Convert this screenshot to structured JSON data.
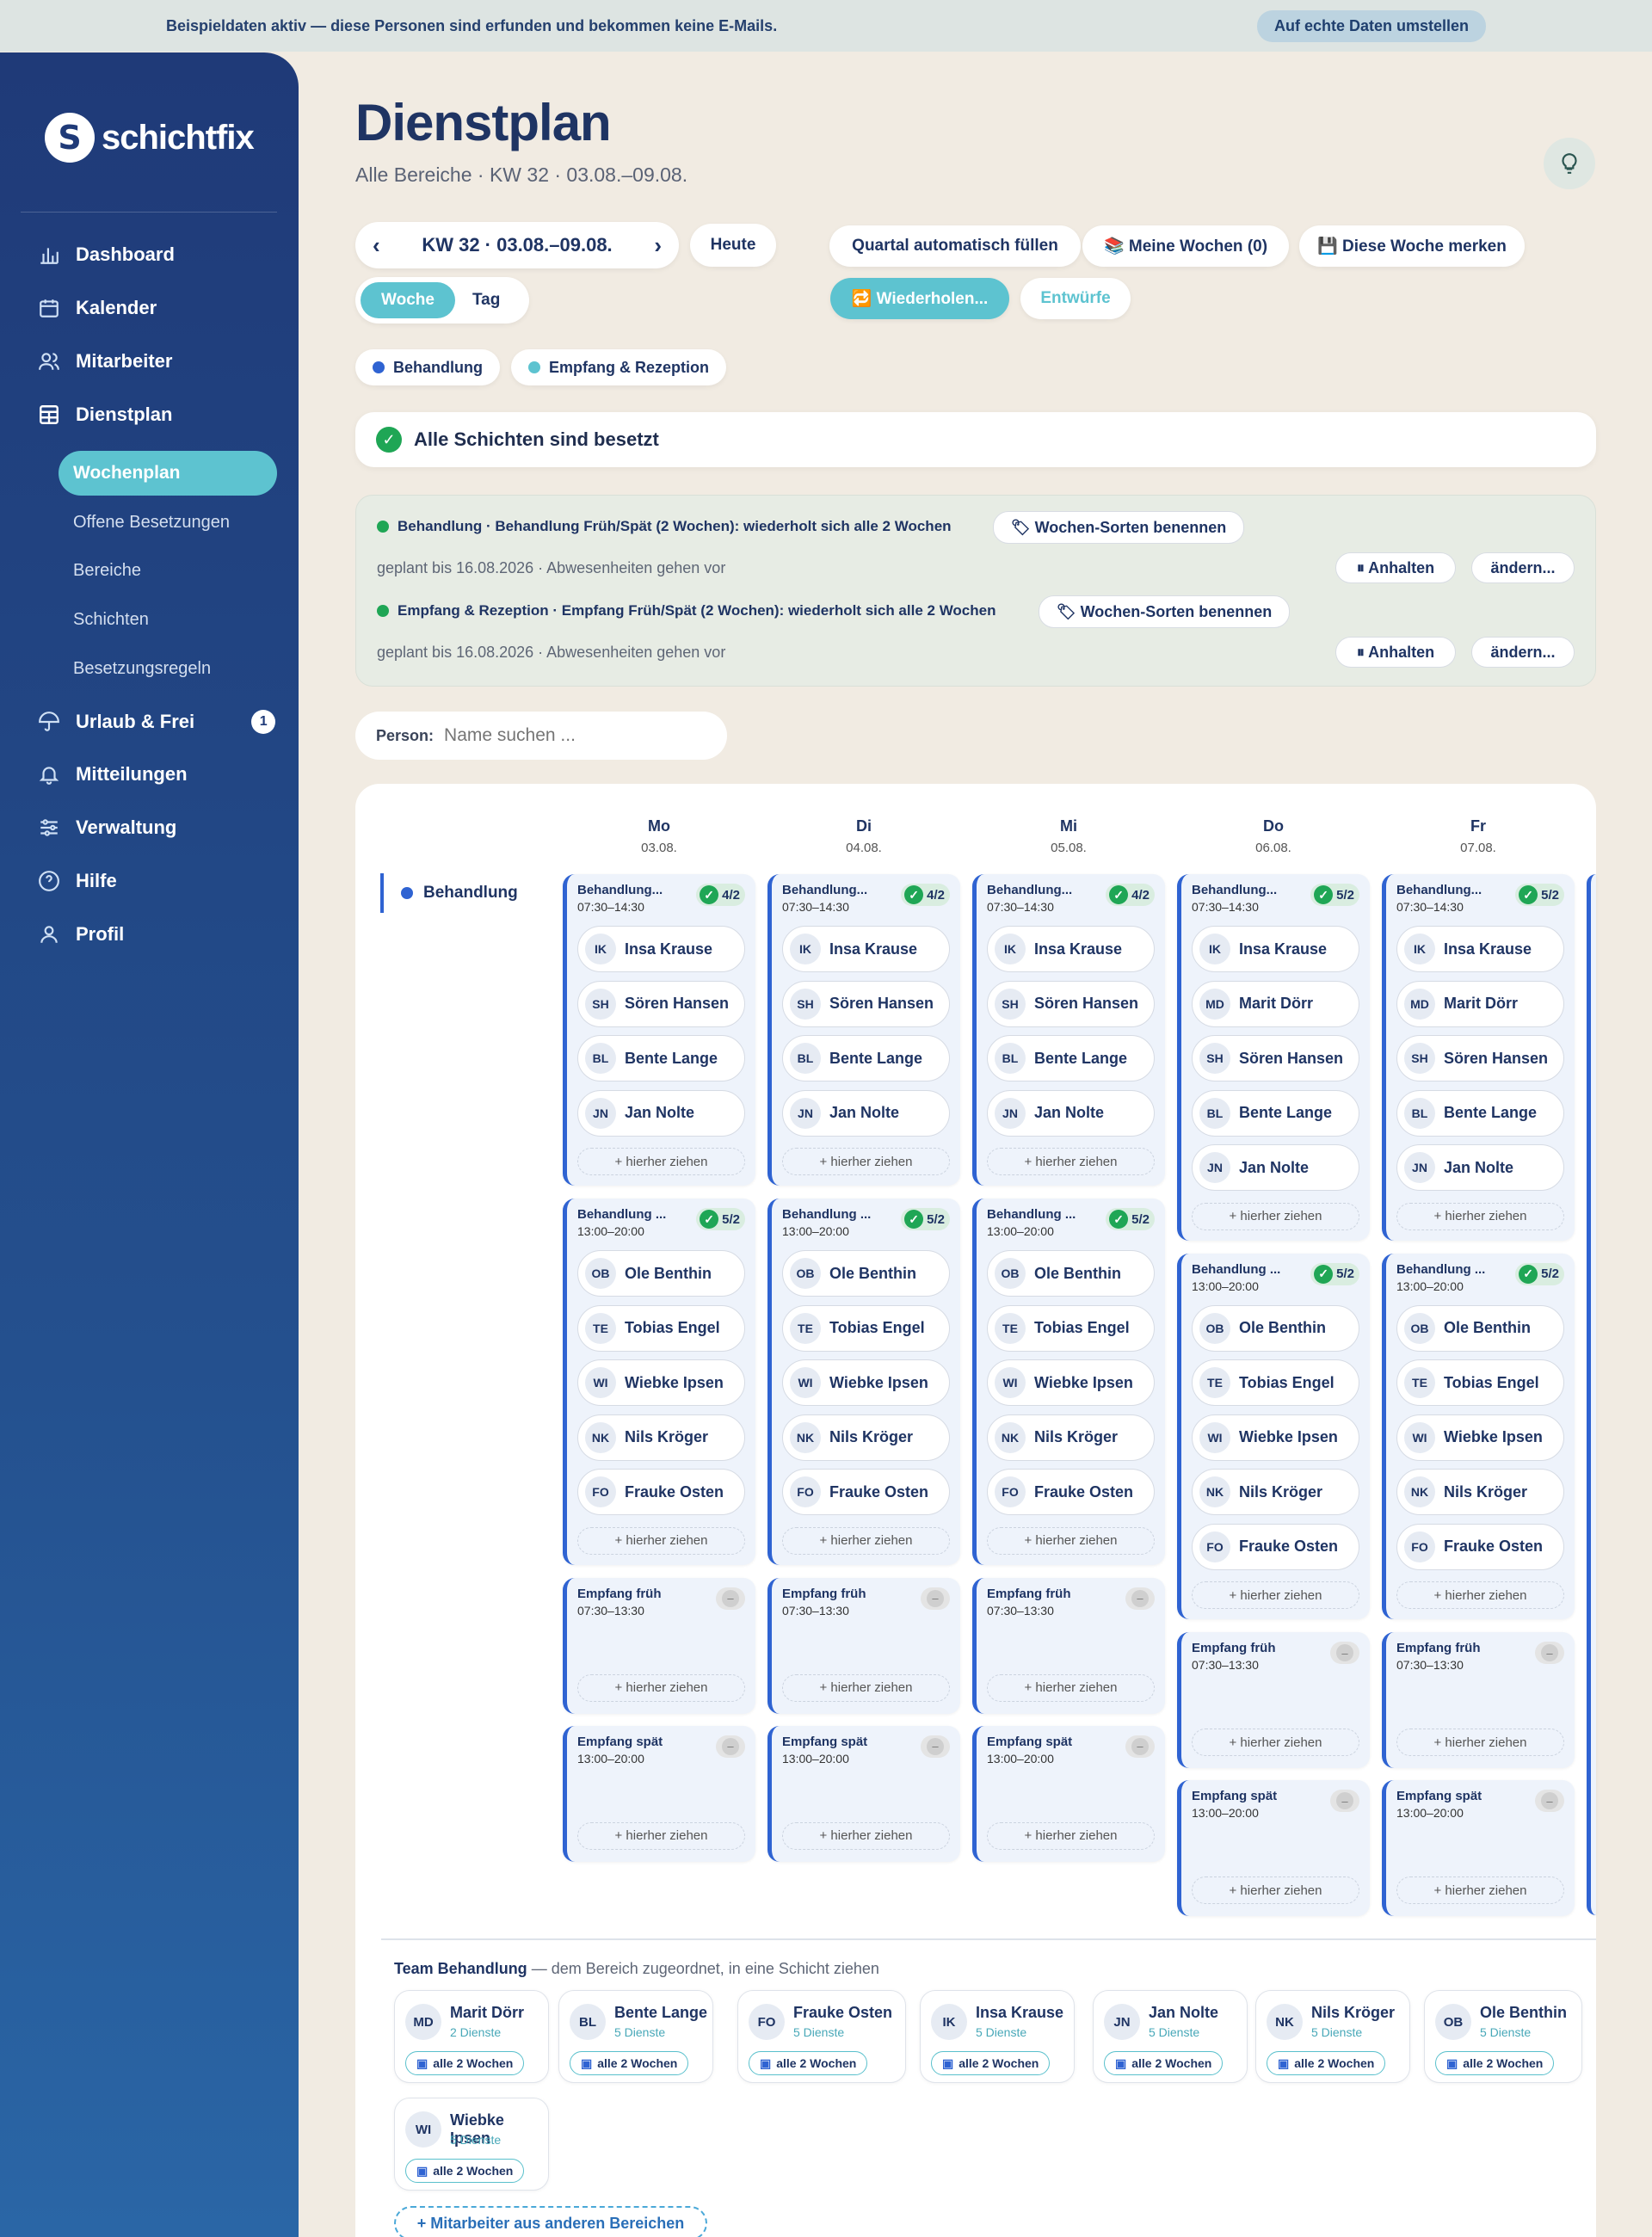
{
  "banner": {
    "text": "Beispieldaten aktiv — diese Personen sind erfunden und bekommen keine E-Mails.",
    "button": "Auf echte Daten umstellen"
  },
  "sidebar": {
    "logo": "schichtfix",
    "items": [
      {
        "label": "Dashboard",
        "icon": "bar-chart-icon"
      },
      {
        "label": "Kalender",
        "icon": "calendar-icon"
      },
      {
        "label": "Mitarbeiter",
        "icon": "users-icon"
      },
      {
        "label": "Dienstplan",
        "icon": "grid-icon"
      },
      {
        "label": "Urlaub & Frei",
        "icon": "umbrella-icon",
        "badge": "1"
      },
      {
        "label": "Mitteilungen",
        "icon": "bell-icon"
      },
      {
        "label": "Verwaltung",
        "icon": "sliders-icon"
      },
      {
        "label": "Hilfe",
        "icon": "help-icon"
      },
      {
        "label": "Profil",
        "icon": "user-icon"
      }
    ],
    "subitems": [
      "Wochenplan",
      "Offene Besetzungen",
      "Bereiche",
      "Schichten",
      "Besetzungsregeln"
    ]
  },
  "page": {
    "title": "Dienstplan",
    "subtitle": "Alle Bereiche · KW 32 · 03.08.–09.08."
  },
  "toolbar": {
    "week": "KW 32 · 03.08.–09.08.",
    "today": "Heute",
    "view_week": "Woche",
    "view_day": "Tag",
    "fill_quarter": "Quartal automatisch füllen",
    "my_weeks": "📚 Meine Wochen (0)",
    "remember": "💾 Diese Woche merken",
    "repeat": "🔁 Wiederholen...",
    "drafts": "Entwürfe"
  },
  "filters": [
    {
      "label": "Behandlung",
      "color": "#2f63d2"
    },
    {
      "label": "Empfang & Rezeption",
      "color": "#5dc3d0"
    }
  ],
  "status": {
    "text": "Alle Schichten sind besetzt"
  },
  "recurrences": [
    {
      "title": "Behandlung · Behandlung Früh/Spät (2 Wochen): wiederholt sich alle 2 Wochen",
      "name_btn": "🏷 Wochen-Sorten benennen",
      "info": "geplant bis 16.08.2026 · Abwesenheiten gehen vor",
      "pause": "⏸ Anhalten",
      "change": "ändern..."
    },
    {
      "title": "Empfang & Rezeption · Empfang Früh/Spät (2 Wochen): wiederholt sich alle 2 Wochen",
      "name_btn": "🏷 Wochen-Sorten benennen",
      "info": "geplant bis 16.08.2026 · Abwesenheiten gehen vor",
      "pause": "⏸ Anhalten",
      "change": "ändern..."
    }
  ],
  "search": {
    "label": "Person:",
    "placeholder": "Name suchen ..."
  },
  "grid": {
    "area": "Behandlung",
    "drop_hint": "+ hierher ziehen",
    "days": [
      {
        "name": "Mo",
        "date": "03.08."
      },
      {
        "name": "Di",
        "date": "04.08."
      },
      {
        "name": "Mi",
        "date": "05.08."
      },
      {
        "name": "Do",
        "date": "06.08."
      },
      {
        "name": "Fr",
        "date": "07.08."
      }
    ],
    "shift_titles": {
      "early": "Behandlung...",
      "early_short": "Behandlung ...",
      "late": "Behandlung ...",
      "empf_early": "Empfang früh",
      "empf_late": "Empfang spät"
    },
    "times": {
      "early": "07:30–14:30",
      "late": "13:00–20:00",
      "empf_early": "07:30–13:30",
      "empf_late": "13:00–20:00"
    },
    "counts": {
      "four": "4/2",
      "five": "5/2",
      "empty": "–"
    },
    "people": {
      "IK": "Insa Krause",
      "SH": "Sören Hansen",
      "BL": "Bente Lange",
      "JN": "Jan Nolte",
      "MD": "Marit Dörr",
      "OB": "Ole Benthin",
      "TE": "Tobias Engel",
      "WI": "Wiebke Ipsen",
      "NK": "Nils Kröger",
      "FO": "Frauke Osten"
    }
  },
  "team": {
    "title": "Team Behandlung",
    "subtitle": " — dem Bereich zugeordnet, in eine Schicht ziehen",
    "badge": "alle 2 Wochen",
    "members": [
      {
        "ini": "MD",
        "name": "Marit Dörr",
        "shifts": "2 Dienste"
      },
      {
        "ini": "BL",
        "name": "Bente Lange",
        "shifts": "5 Dienste"
      },
      {
        "ini": "FO",
        "name": "Frauke Osten",
        "shifts": "5 Dienste"
      },
      {
        "ini": "IK",
        "name": "Insa Krause",
        "shifts": "5 Dienste"
      },
      {
        "ini": "JN",
        "name": "Jan Nolte",
        "shifts": "5 Dienste"
      },
      {
        "ini": "NK",
        "name": "Nils Kröger",
        "shifts": "5 Dienste"
      },
      {
        "ini": "OB",
        "name": "Ole Benthin",
        "shifts": "5 Dienste"
      },
      {
        "ini": "WI",
        "name": "Wiebke Ipsen",
        "shifts": "5 Dienste"
      }
    ],
    "add_other": "+ Mitarbeiter aus anderen Bereichen"
  }
}
